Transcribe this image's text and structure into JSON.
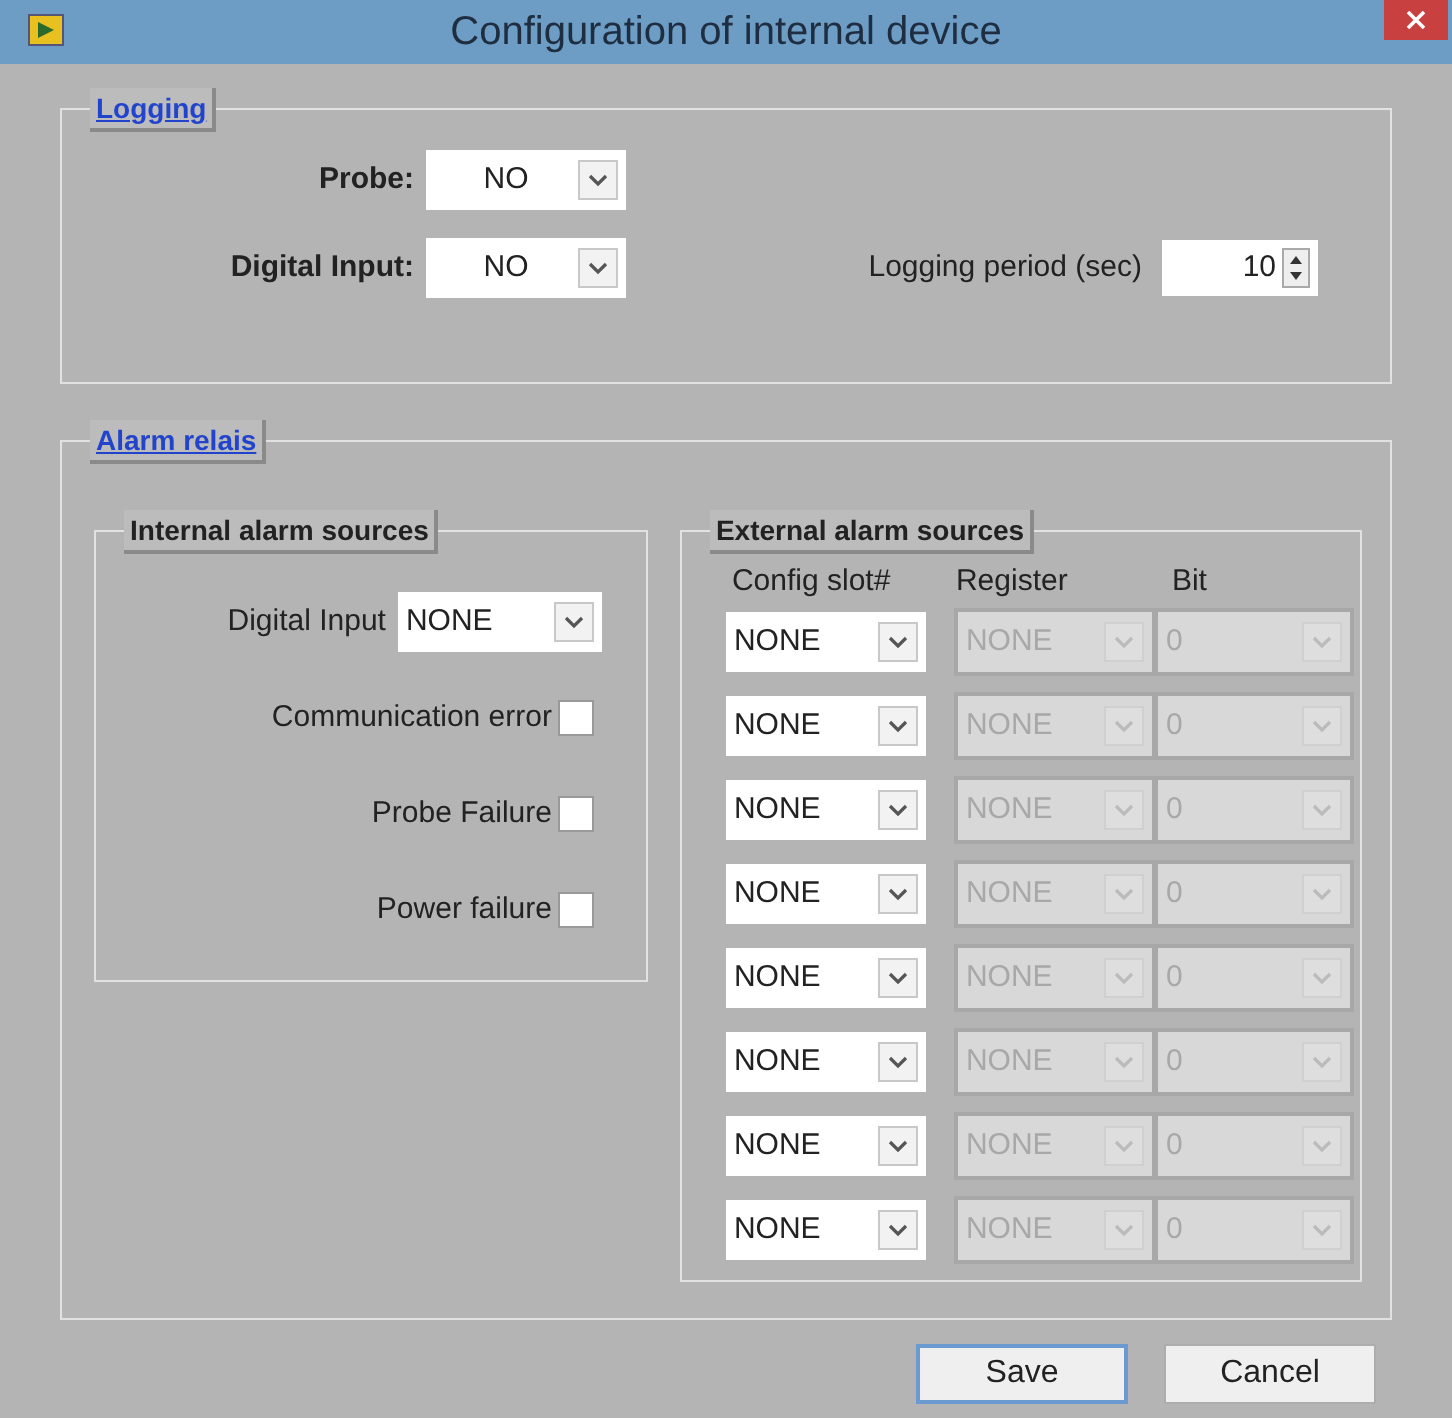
{
  "window": {
    "title": "Configuration of internal device"
  },
  "logging": {
    "title": "Logging",
    "probe": {
      "label": "Probe:",
      "value": "NO"
    },
    "digital_input": {
      "label": "Digital Input:",
      "value": "NO"
    },
    "period": {
      "label": "Logging period (sec)",
      "value": "10"
    }
  },
  "alarm_relais": {
    "title": "Alarm relais",
    "internal": {
      "title": "Internal alarm sources",
      "digital_input": {
        "label": "Digital Input",
        "value": "NONE"
      },
      "checkboxes": [
        {
          "label": "Communication error",
          "checked": false
        },
        {
          "label": "Probe Failure",
          "checked": false
        },
        {
          "label": "Power failure",
          "checked": false
        }
      ]
    },
    "external": {
      "title": "External alarm sources",
      "columns": [
        "Config slot#",
        "Register",
        "Bit"
      ],
      "rows": [
        {
          "config_slot": "NONE",
          "register": "NONE",
          "bit": "0",
          "disabled": true
        },
        {
          "config_slot": "NONE",
          "register": "NONE",
          "bit": "0",
          "disabled": true
        },
        {
          "config_slot": "NONE",
          "register": "NONE",
          "bit": "0",
          "disabled": true
        },
        {
          "config_slot": "NONE",
          "register": "NONE",
          "bit": "0",
          "disabled": true
        },
        {
          "config_slot": "NONE",
          "register": "NONE",
          "bit": "0",
          "disabled": true
        },
        {
          "config_slot": "NONE",
          "register": "NONE",
          "bit": "0",
          "disabled": true
        },
        {
          "config_slot": "NONE",
          "register": "NONE",
          "bit": "0",
          "disabled": true
        },
        {
          "config_slot": "NONE",
          "register": "NONE",
          "bit": "0",
          "disabled": true
        }
      ]
    }
  },
  "buttons": [
    {
      "label": "Save",
      "default": true
    },
    {
      "label": "Cancel",
      "default": false
    }
  ]
}
